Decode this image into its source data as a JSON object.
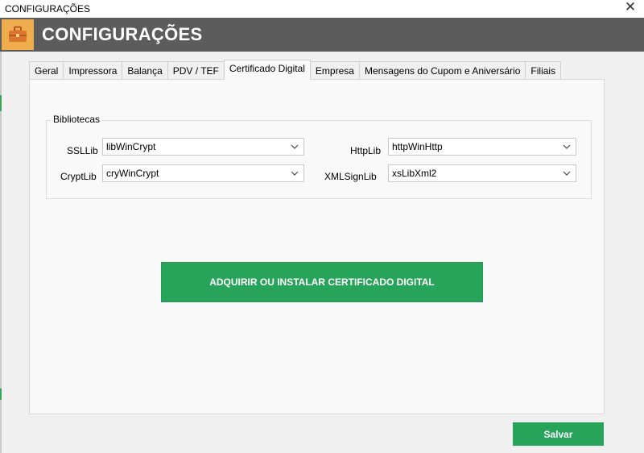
{
  "window": {
    "title": "CONFIGURAÇÕES",
    "close_icon": "close-icon"
  },
  "header": {
    "title": "CONFIGURAÇÕES",
    "logo_icon": "briefcase-icon",
    "logo_color": "#f0ad4e",
    "background": "#5c5c5c"
  },
  "tabs": [
    {
      "label": "Geral"
    },
    {
      "label": "Impressora"
    },
    {
      "label": "Balança"
    },
    {
      "label": "PDV / TEF"
    },
    {
      "label": "Certificado Digital"
    },
    {
      "label": "Empresa"
    },
    {
      "label": "Mensagens do Cupom e Aniversário"
    },
    {
      "label": "Filiais"
    }
  ],
  "active_tab": "Certificado Digital",
  "bibliotecas": {
    "group_label": "Bibliotecas",
    "ssllib": {
      "label": "SSLLib",
      "value": "libWinCrypt"
    },
    "cryptlib": {
      "label": "CryptLib",
      "value": "cryWinCrypt"
    },
    "httplib": {
      "label": "HttpLib",
      "value": "httpWinHttp"
    },
    "xmlsignlib": {
      "label": "XMLSignLib",
      "value": "xsLibXml2"
    }
  },
  "actions": {
    "certificate_button": "ADQUIRIR OU INSTALAR CERTIFICADO DIGITAL",
    "save_button": "Salvar",
    "accent": "#27a35a"
  }
}
